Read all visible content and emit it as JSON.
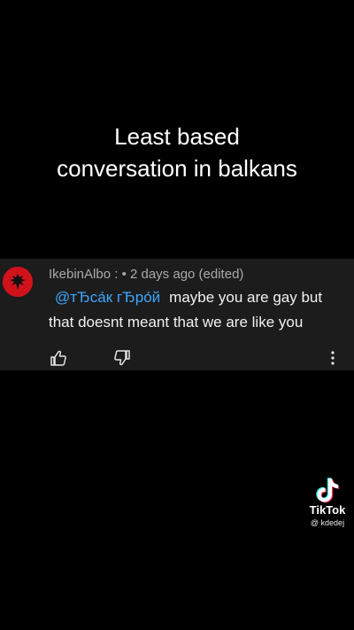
{
  "caption": {
    "line1": "Least based",
    "line2": "conversation in balkans"
  },
  "comment": {
    "author": "IkebinAlbo",
    "separator": " : • ",
    "timestamp": "2 days ago (edited)",
    "mention": "@тЂса́к гЂро́й",
    "text_line1": "maybe you are gay but",
    "text_line2": "that doesnt meant that we are like you"
  },
  "actions": {
    "like_icon": "thumbs-up-icon",
    "dislike_icon": "thumbs-down-icon",
    "more_icon": "more-vertical-icon"
  },
  "watermark": {
    "brand": "TikTok",
    "handle": "@ kdedej"
  },
  "colors": {
    "background": "#000000",
    "card": "#1c1c1c",
    "mention": "#3ea6ff",
    "avatar": "#d0121b"
  }
}
